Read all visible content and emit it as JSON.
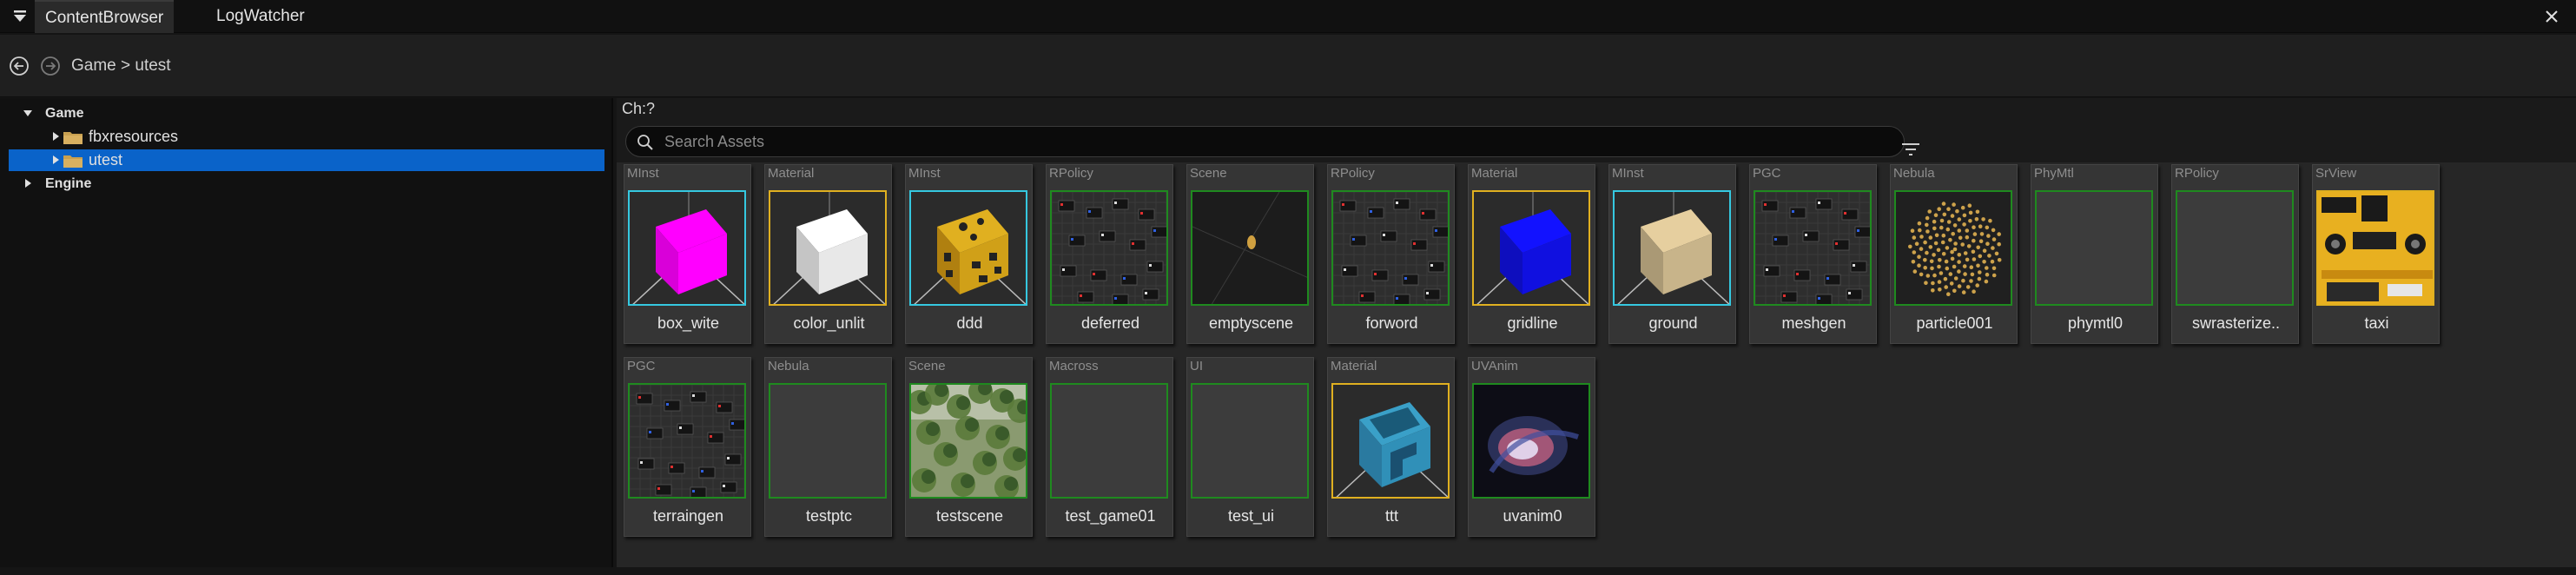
{
  "tabs": [
    {
      "label": "ContentBrowser",
      "active": true
    },
    {
      "label": "LogWatcher",
      "active": false
    }
  ],
  "breadcrumb": "Game > utest",
  "tree": [
    {
      "label": "Game",
      "bold": true,
      "expanded": true,
      "depth": 0,
      "folder": false,
      "selected": false
    },
    {
      "label": "fbxresources",
      "bold": false,
      "expanded": false,
      "depth": 1,
      "folder": true,
      "selected": false
    },
    {
      "label": "utest",
      "bold": false,
      "expanded": false,
      "depth": 1,
      "folder": true,
      "selected": true
    },
    {
      "label": "Engine",
      "bold": true,
      "expanded": false,
      "depth": 0,
      "folder": false,
      "selected": false
    }
  ],
  "content": {
    "ch_label": "Ch:?",
    "search_placeholder": "Search Assets",
    "search_value": ""
  },
  "assets": [
    {
      "type": "MInst",
      "name": "box_wite",
      "border": "#35c8e0",
      "thumb": "cube",
      "color": "#ff00ff"
    },
    {
      "type": "Material",
      "name": "color_unlit",
      "border": "#e0b020",
      "thumb": "cube",
      "color": "#e8e8e8"
    },
    {
      "type": "MInst",
      "name": "ddd",
      "border": "#35c8e0",
      "thumb": "cube-pattern",
      "color": "#e0b020"
    },
    {
      "type": "RPolicy",
      "name": "deferred",
      "border": "#1f8a1f",
      "thumb": "graph",
      "color": "#2a2a2a"
    },
    {
      "type": "Scene",
      "name": "emptyscene",
      "border": "#1f8a1f",
      "thumb": "dot",
      "color": "#d0a040"
    },
    {
      "type": "RPolicy",
      "name": "forword",
      "border": "#1f8a1f",
      "thumb": "graph",
      "color": "#2a2a2a"
    },
    {
      "type": "Material",
      "name": "gridline",
      "border": "#e0b020",
      "thumb": "cube",
      "color": "#1010e0"
    },
    {
      "type": "MInst",
      "name": "ground",
      "border": "#35c8e0",
      "thumb": "cube",
      "color": "#c8b48a"
    },
    {
      "type": "PGC",
      "name": "meshgen",
      "border": "#1f8a1f",
      "thumb": "graph",
      "color": "#2a2a2a"
    },
    {
      "type": "Nebula",
      "name": "particle001",
      "border": "#1f8a1f",
      "thumb": "particles",
      "color": "#e0b050"
    },
    {
      "type": "PhyMtl",
      "name": "phymtl0",
      "border": "#1f8a1f",
      "thumb": "empty",
      "color": "#3c3c3c"
    },
    {
      "type": "RPolicy",
      "name": "swrasterize..",
      "border": "#1f8a1f",
      "thumb": "empty",
      "color": "#3c3c3c"
    },
    {
      "type": "SrView",
      "name": "taxi",
      "border": "#e0b020",
      "thumb": "taxi",
      "color": "#e8b020"
    },
    {
      "type": "PGC",
      "name": "terraingen",
      "border": "#1f8a1f",
      "thumb": "graph",
      "color": "#2a2a2a"
    },
    {
      "type": "Nebula",
      "name": "testptc",
      "border": "#1f8a1f",
      "thumb": "empty",
      "color": "#3c3c3c"
    },
    {
      "type": "Scene",
      "name": "testscene",
      "border": "#1f8a1f",
      "thumb": "forest",
      "color": "#5a7a3a"
    },
    {
      "type": "Macross",
      "name": "test_game01",
      "border": "#1f8a1f",
      "thumb": "empty",
      "color": "#3c3c3c"
    },
    {
      "type": "UI",
      "name": "test_ui",
      "border": "#1f8a1f",
      "thumb": "empty",
      "color": "#3c3c3c"
    },
    {
      "type": "Material",
      "name": "ttt",
      "border": "#e0b020",
      "thumb": "cube-teal",
      "color": "#3aa0c8"
    },
    {
      "type": "UVAnim",
      "name": "uvanim0",
      "border": "#1f8a1f",
      "thumb": "swirl",
      "color": "#c06080"
    }
  ],
  "colors": {
    "selection": "#0a63c9",
    "minst_border": "#35c8e0",
    "material_border": "#e0b020",
    "other_border": "#1f8a1f"
  },
  "icons": {
    "menu": "menu-dropdown-icon",
    "close": "close-icon",
    "back": "back-arrow-icon",
    "forward": "forward-arrow-icon",
    "search": "search-icon",
    "filter": "filter-icon",
    "folder": "folder-icon"
  }
}
